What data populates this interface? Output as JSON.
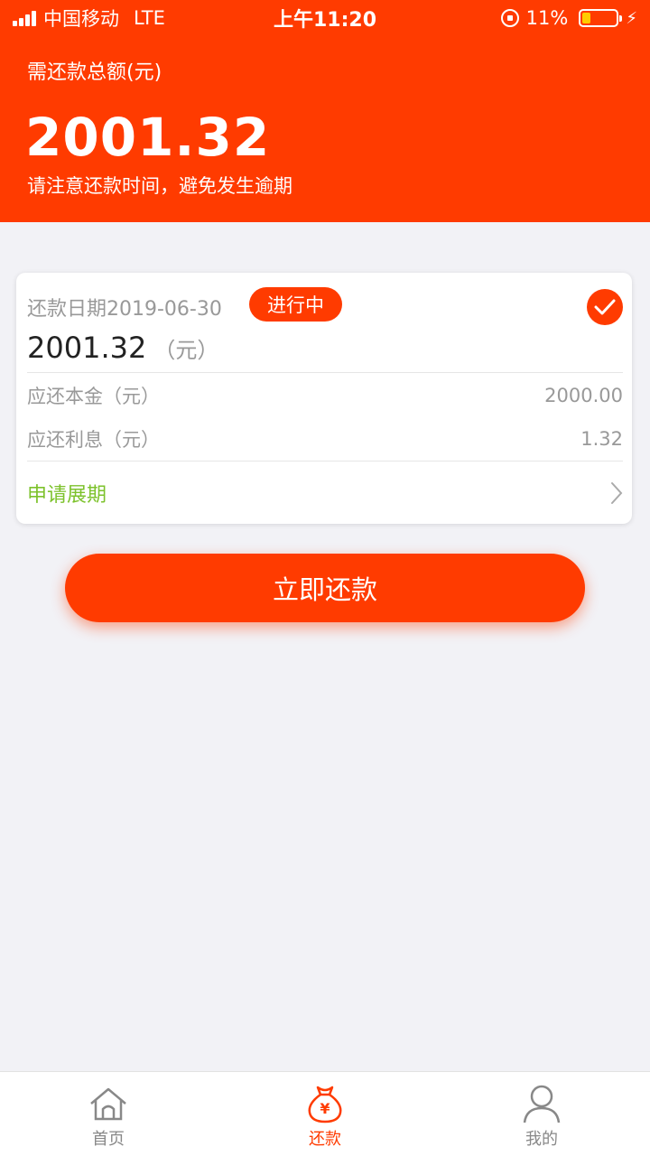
{
  "status_bar": {
    "carrier": "中国移动",
    "network": "LTE",
    "time": "上午11:20",
    "battery": "11%",
    "battery_level": 0.11
  },
  "header": {
    "total_label": "需还款总额(元)",
    "total_amount": "2001.32",
    "tip": "请注意还款时间，避免发生逾期"
  },
  "card": {
    "date_label": "还款日期2019-06-30",
    "status_badge": "进行中",
    "amount": "2001.32",
    "amount_unit": "（元）",
    "rows": [
      {
        "label": "应还本金（元）",
        "value": "2000.00"
      },
      {
        "label": "应还利息（元）",
        "value": "1.32"
      }
    ],
    "extend_label": "申请展期"
  },
  "pay_button": "立即还款",
  "tabbar": {
    "items": [
      {
        "label": "首页",
        "icon": "home-icon"
      },
      {
        "label": "还款",
        "icon": "money-bag-icon"
      },
      {
        "label": "我的",
        "icon": "user-icon"
      }
    ]
  },
  "colors": {
    "accent": "#ff3b00",
    "link_green": "#7dc22c"
  }
}
